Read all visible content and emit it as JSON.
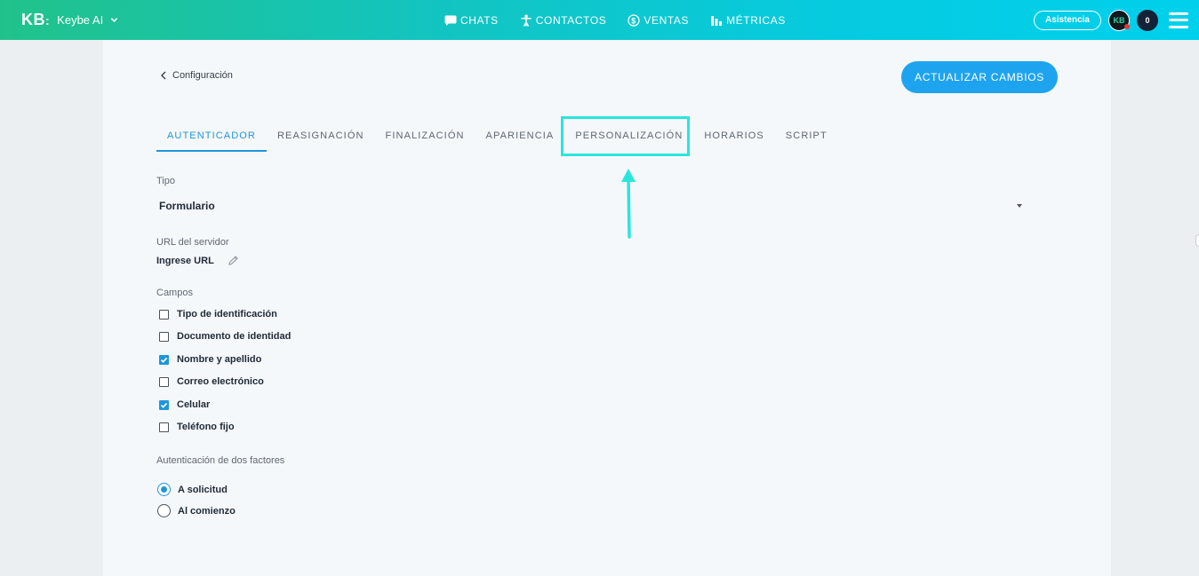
{
  "topbar": {
    "logo_text": "KB",
    "logo_colon": ":",
    "brand_name": "Keybe AI",
    "nav": [
      {
        "label": "CHATS",
        "icon": "chat-icon"
      },
      {
        "label": "CONTACTOS",
        "icon": "person-icon"
      },
      {
        "label": "VENTAS",
        "icon": "dollar-icon"
      },
      {
        "label": "MÉTRICAS",
        "icon": "bar-chart-icon"
      }
    ],
    "assist_label": "Asistencia",
    "avatar_initials": "KB",
    "notification_count": "0",
    "gradient": [
      "#21c28a",
      "#00d0ec"
    ]
  },
  "page": {
    "back_label": "Configuración",
    "update_button": "ACTUALIZAR CAMBIOS",
    "accent_color": "#1e96da",
    "highlight_color": "#29e6dd",
    "tabs": [
      {
        "label": "AUTENTICADOR",
        "active": true
      },
      {
        "label": "REASIGNACIÓN",
        "active": false
      },
      {
        "label": "FINALIZACIÓN",
        "active": false
      },
      {
        "label": "APARIENCIA",
        "active": false
      },
      {
        "label": "PERSONALIZACIÓN",
        "active": false
      },
      {
        "label": "HORARIOS",
        "active": false
      },
      {
        "label": "SCRIPT",
        "active": false
      }
    ]
  },
  "form": {
    "tipo_label": "Tipo",
    "tipo_value": "Formulario",
    "url_label": "URL del servidor",
    "url_value": "Ingrese URL",
    "campos_label": "Campos",
    "campos": [
      {
        "label": "Tipo de identificación",
        "checked": false
      },
      {
        "label": "Documento de identidad",
        "checked": false
      },
      {
        "label": "Nombre y apellido",
        "checked": true
      },
      {
        "label": "Correo electrónico",
        "checked": false
      },
      {
        "label": "Celular",
        "checked": true
      },
      {
        "label": "Teléfono fijo",
        "checked": false
      }
    ],
    "two_factor_label": "Autenticación de dos factores",
    "two_factor_options": [
      {
        "label": "A solicitud",
        "selected": true
      },
      {
        "label": "Al comienzo",
        "selected": false
      }
    ]
  }
}
